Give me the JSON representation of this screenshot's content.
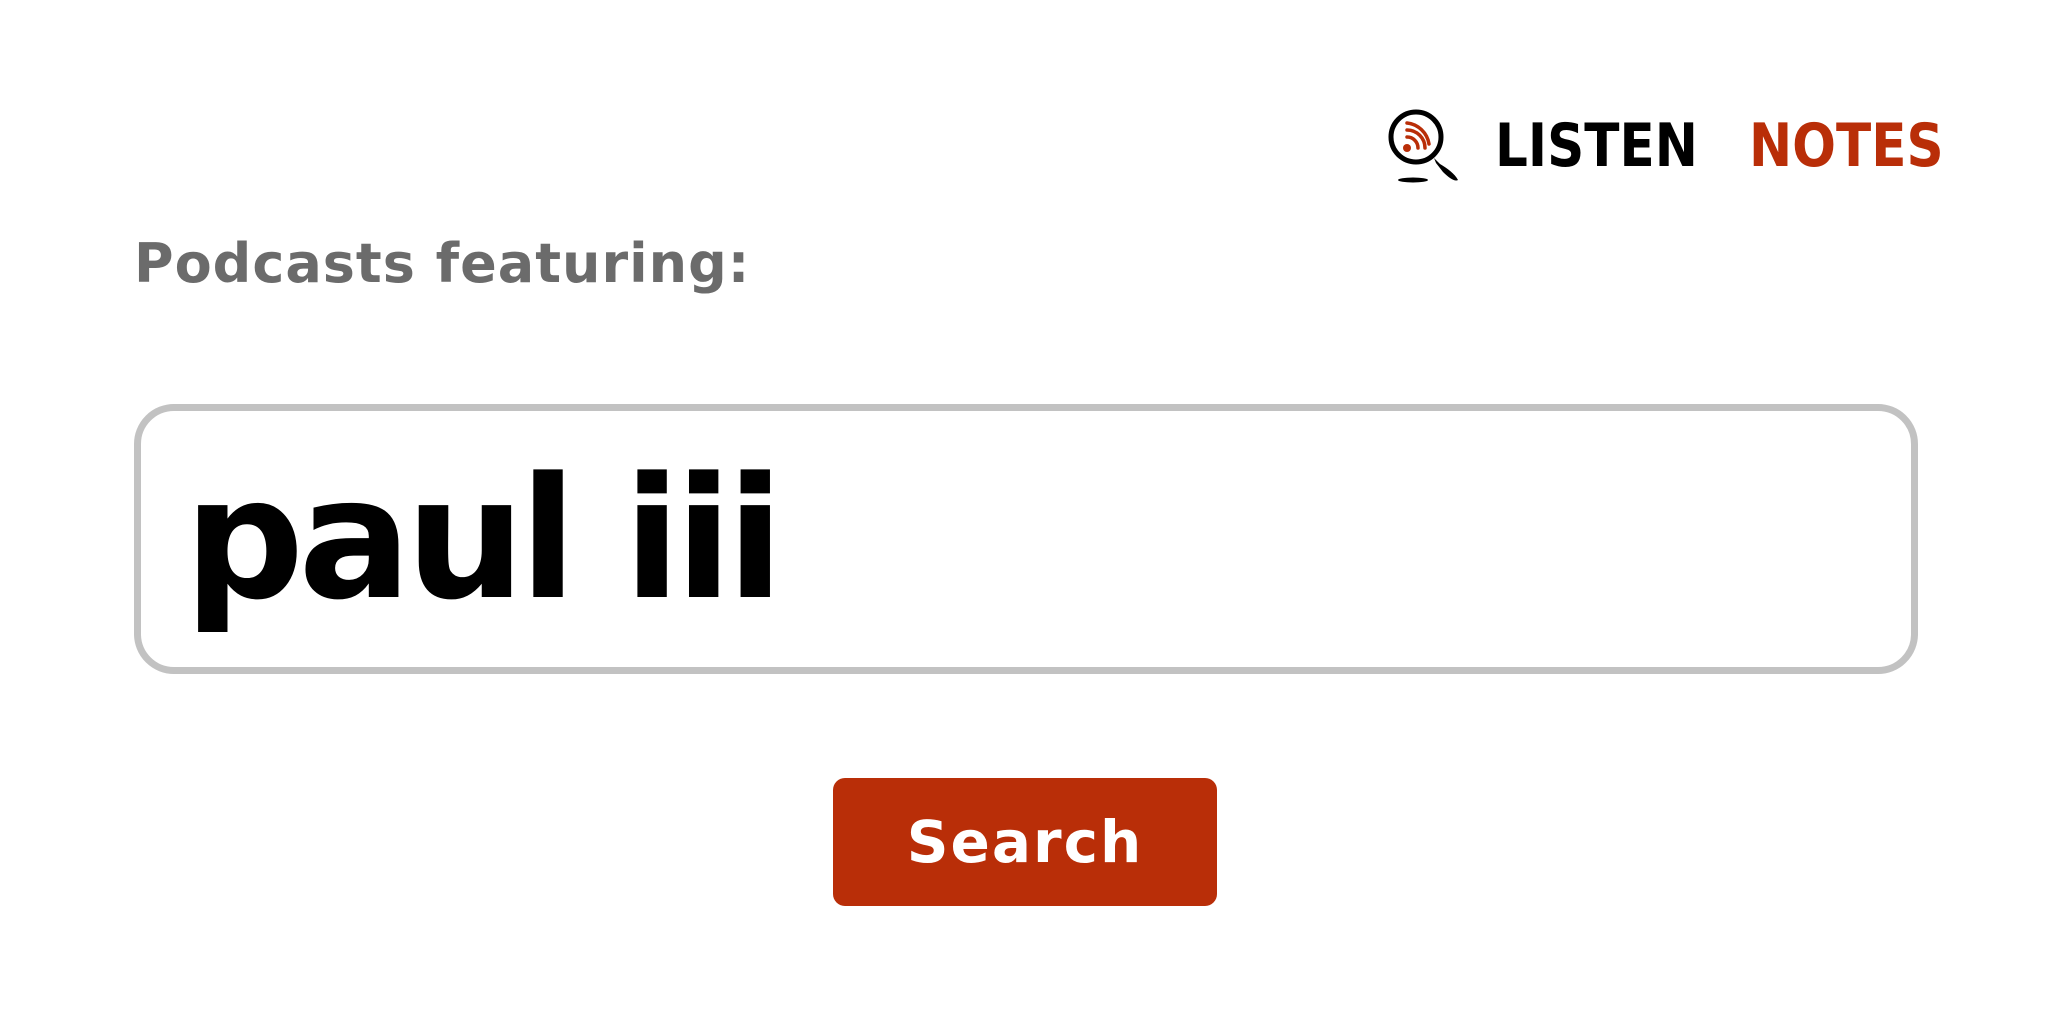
{
  "logo": {
    "icon": "podcast-search-icon",
    "word_1": "LISTEN",
    "word_2": "NOTES",
    "colors": {
      "word_1": "#000000",
      "word_2": "#b92e08"
    }
  },
  "heading": "Podcasts featuring:",
  "search": {
    "value": "paul iii",
    "icon": "none"
  },
  "button": {
    "label": "Search",
    "color": "#b92e08"
  }
}
